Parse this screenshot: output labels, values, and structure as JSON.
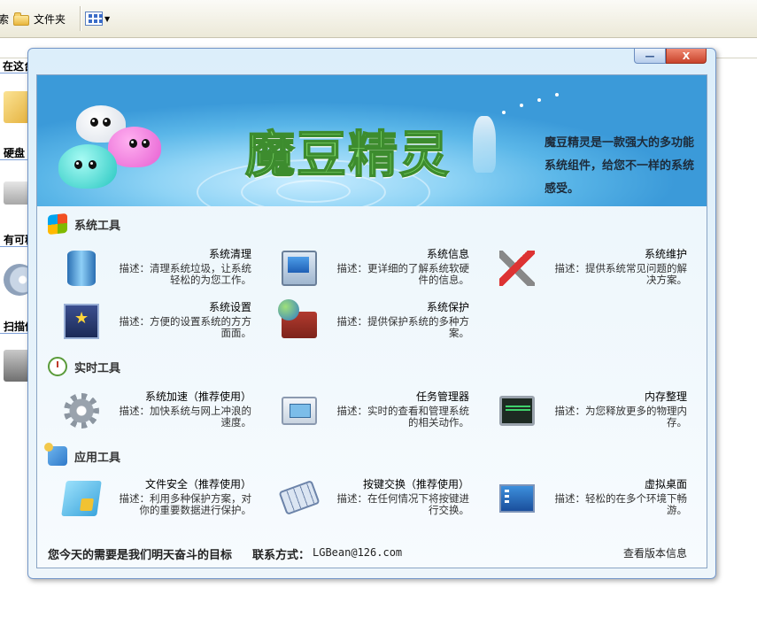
{
  "explorer": {
    "search_fragment": "索",
    "folders_label": "文件夹",
    "section_stored": "在这台计算机上存储的文件",
    "hard_disk": "硬盘",
    "removable": "有可移",
    "scanner": "扫描仪"
  },
  "window": {
    "min_symbol": "—",
    "close_symbol": "X"
  },
  "banner": {
    "title": "魔豆精灵",
    "description": "魔豆精灵是一款强大的多功能系统组件，给您不一样的系统感受。"
  },
  "sections": {
    "system": "系统工具",
    "realtime": "实时工具",
    "app": "应用工具"
  },
  "tools": {
    "clean": {
      "name": "系统清理",
      "desc": "描述：清理系统垃圾，让系统轻松的为您工作。"
    },
    "info": {
      "name": "系统信息",
      "desc": "描述：更详细的了解系统软硬件的信息。"
    },
    "maint": {
      "name": "系统维护",
      "desc": "描述：提供系统常见问题的解决方案。"
    },
    "setting": {
      "name": "系统设置",
      "desc": "描述：方便的设置系统的方方面面。"
    },
    "protect": {
      "name": "系统保护",
      "desc": "描述：提供保护系统的多种方案。"
    },
    "speed": {
      "name": "系统加速（推荐使用）",
      "desc": "描述：加快系统与网上冲浪的速度。"
    },
    "task": {
      "name": "任务管理器",
      "desc": "描述：实时的查看和管理系统的相关动作。"
    },
    "memory": {
      "name": "内存整理",
      "desc": "描述：为您释放更多的物理内存。"
    },
    "file": {
      "name": "文件安全（推荐使用）",
      "desc": "描述：利用多种保护方案，对你的重要数据进行保护。"
    },
    "keys": {
      "name": "按键交换（推荐使用）",
      "desc": "描述：在任何情况下将按键进行交换。"
    },
    "desktop": {
      "name": "虚拟桌面",
      "desc": "描述：轻松的在多个环境下畅游。"
    }
  },
  "footer": {
    "motto": "您今天的需要是我们明天奋斗的目标",
    "contact_label": "联系方式：",
    "email": "LGBean@126.com",
    "version_link": "查看版本信息"
  }
}
